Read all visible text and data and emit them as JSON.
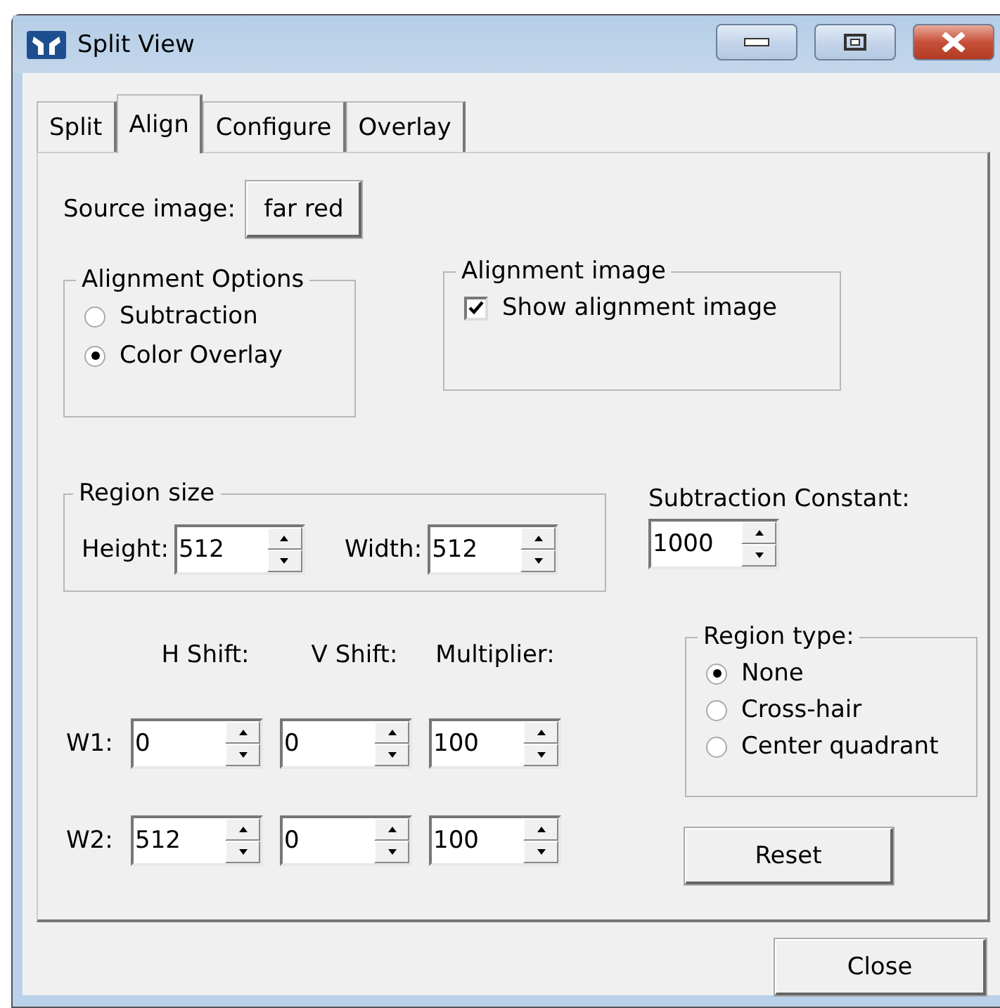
{
  "window": {
    "title": "Split View"
  },
  "tabs": [
    {
      "label": "Split",
      "selected": false
    },
    {
      "label": "Align",
      "selected": true
    },
    {
      "label": "Configure",
      "selected": false
    },
    {
      "label": "Overlay",
      "selected": false
    }
  ],
  "source_image": {
    "label": "Source image:",
    "button": "far red"
  },
  "alignment_options": {
    "title": "Alignment Options",
    "options": [
      {
        "label": "Subtraction",
        "selected": false
      },
      {
        "label": "Color Overlay",
        "selected": true
      }
    ]
  },
  "alignment_image": {
    "title": "Alignment image",
    "checkbox": {
      "label": "Show alignment image",
      "checked": true
    }
  },
  "region_size": {
    "title": "Region size",
    "fields": [
      {
        "label": "Height:",
        "value": "512"
      },
      {
        "label": "Width:",
        "value": "512"
      }
    ]
  },
  "subtraction_constant": {
    "label": "Subtraction Constant:",
    "value": "1000"
  },
  "shift_table": {
    "columns": [
      "H Shift:",
      "V Shift:",
      "Multiplier:"
    ],
    "rows": [
      {
        "label": "W1:",
        "values": [
          "0",
          "0",
          "100"
        ]
      },
      {
        "label": "W2:",
        "values": [
          "512",
          "0",
          "100"
        ]
      }
    ]
  },
  "region_type": {
    "title": "Region type:",
    "options": [
      {
        "label": "None",
        "selected": true
      },
      {
        "label": "Cross-hair",
        "selected": false
      },
      {
        "label": "Center quadrant",
        "selected": false
      }
    ]
  },
  "buttons": {
    "reset": "Reset",
    "close": "Close"
  }
}
